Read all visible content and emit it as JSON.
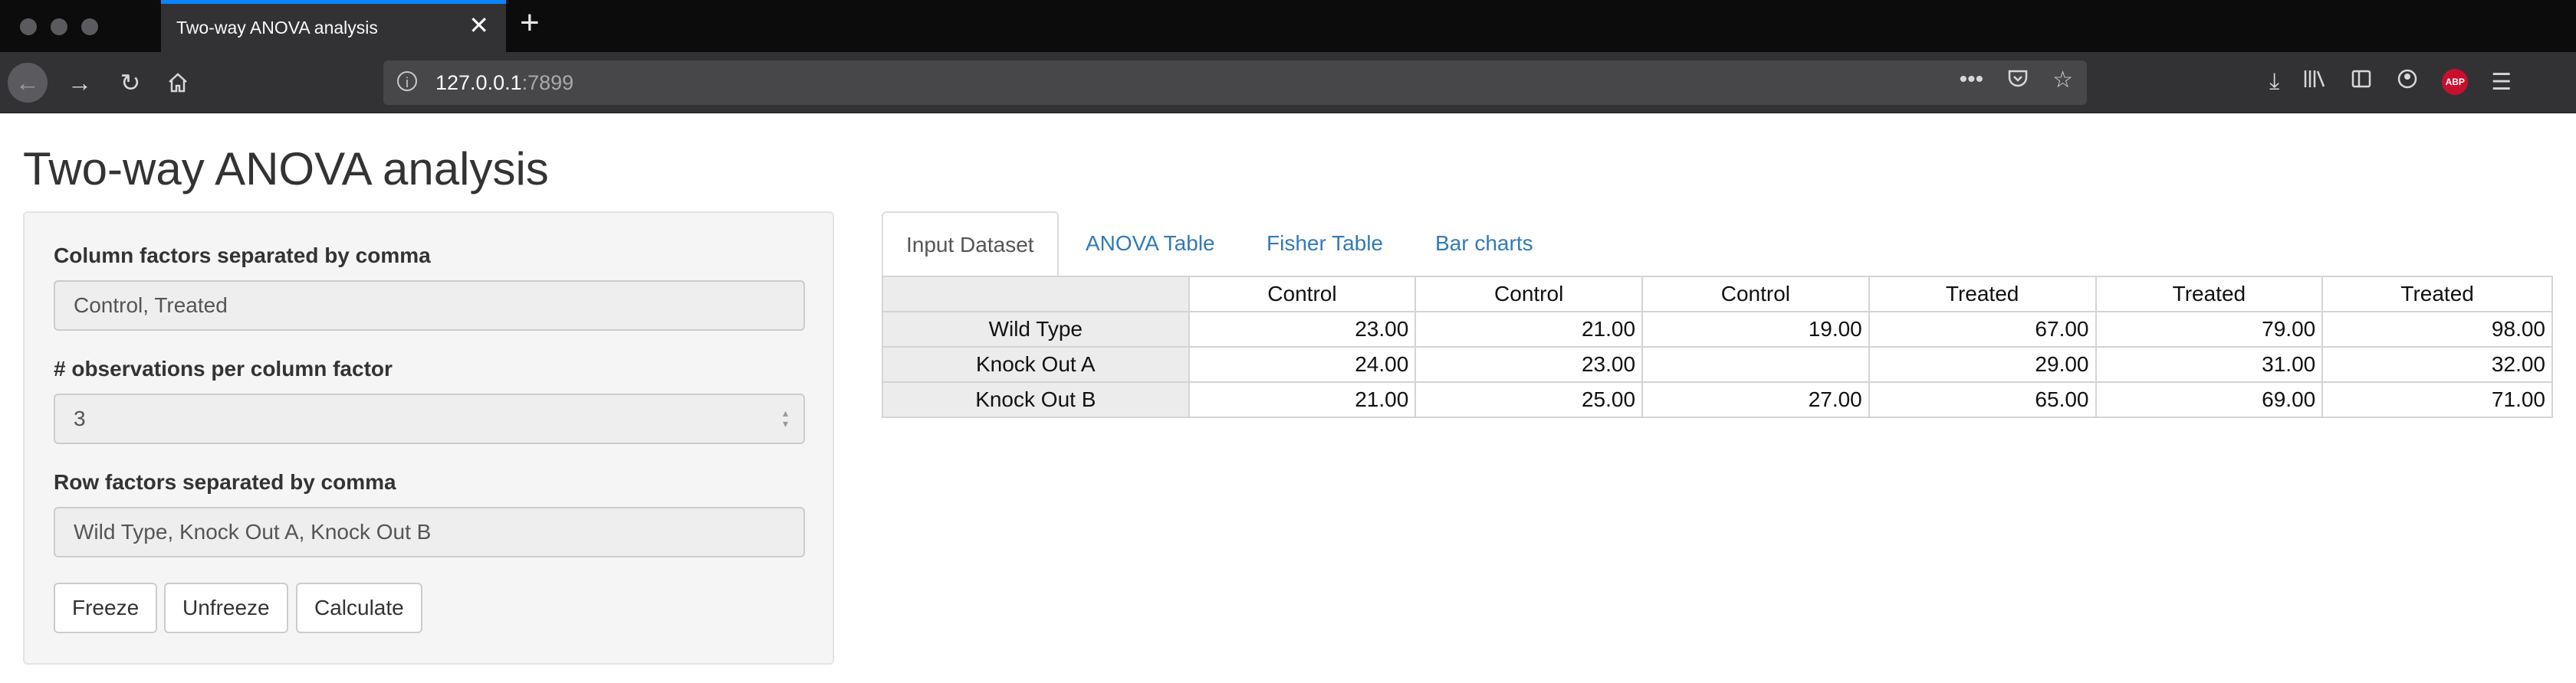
{
  "browser": {
    "tab_title": "Two-way ANOVA analysis",
    "url_host": "127.0.0.1",
    "url_port": ":7899",
    "abp_label": "ABP"
  },
  "page": {
    "title": "Two-way ANOVA analysis"
  },
  "sidebar": {
    "column_factors_label": "Column factors separated by comma",
    "column_factors_value": "Control, Treated",
    "observations_label": "# observations per column factor",
    "observations_value": "3",
    "row_factors_label": "Row factors separated by comma",
    "row_factors_value": "Wild Type, Knock Out A, Knock Out B",
    "buttons": [
      "Freeze",
      "Unfreeze",
      "Calculate"
    ]
  },
  "tabs": [
    {
      "label": "Input Dataset",
      "active": true
    },
    {
      "label": "ANOVA Table",
      "active": false
    },
    {
      "label": "Fisher Table",
      "active": false
    },
    {
      "label": "Bar charts",
      "active": false
    }
  ],
  "table": {
    "columns": [
      "Control",
      "Control",
      "Control",
      "Treated",
      "Treated",
      "Treated"
    ],
    "rows": [
      {
        "name": "Wild Type",
        "cells": [
          "23.00",
          "21.00",
          "19.00",
          "67.00",
          "79.00",
          "98.00"
        ]
      },
      {
        "name": "Knock Out A",
        "cells": [
          "24.00",
          "23.00",
          "",
          "29.00",
          "31.00",
          "32.00"
        ]
      },
      {
        "name": "Knock Out B",
        "cells": [
          "21.00",
          "25.00",
          "27.00",
          "65.00",
          "69.00",
          "71.00"
        ]
      }
    ]
  }
}
